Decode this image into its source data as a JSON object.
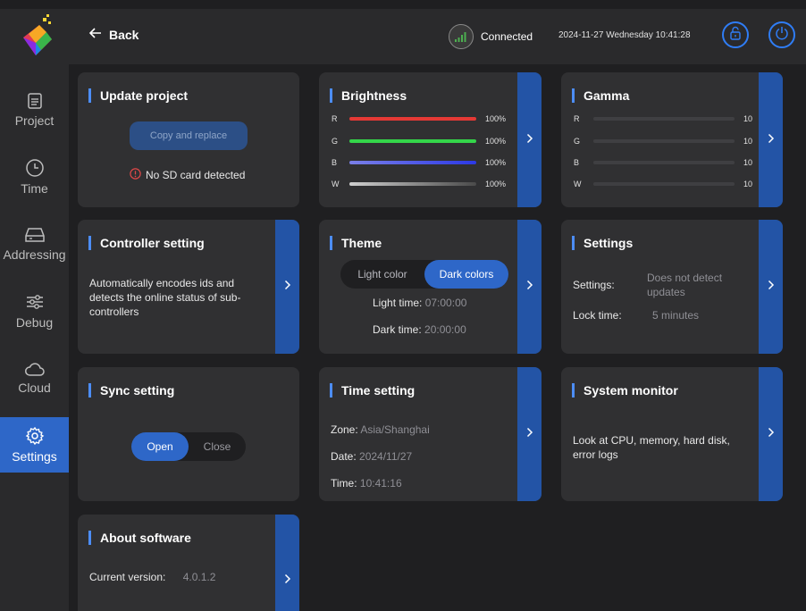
{
  "header": {
    "back_label": "Back",
    "connection_status": "Connected",
    "datetime": "2024-11-27 Wednesday 10:41:28"
  },
  "sidebar": {
    "items": [
      {
        "label": "Project",
        "icon": "document-icon"
      },
      {
        "label": "Time",
        "icon": "clock-icon"
      },
      {
        "label": "Addressing",
        "icon": "drive-icon"
      },
      {
        "label": "Debug",
        "icon": "sliders-icon"
      },
      {
        "label": "Cloud",
        "icon": "cloud-icon"
      },
      {
        "label": "Settings",
        "icon": "gear-icon",
        "active": true
      }
    ]
  },
  "update_project": {
    "title": "Update project",
    "button": "Copy and replace",
    "warning": "No SD card detected"
  },
  "brightness": {
    "title": "Brightness",
    "channels": [
      {
        "label": "R",
        "value": "100%",
        "color": "#e53935"
      },
      {
        "label": "G",
        "value": "100%",
        "color": "#34d64a"
      },
      {
        "label": "B",
        "value": "100%",
        "color": "#2c39e6"
      },
      {
        "label": "W",
        "value": "100%",
        "color": "#bdbdbd"
      }
    ]
  },
  "gamma": {
    "title": "Gamma",
    "channels": [
      {
        "label": "R",
        "value": "10"
      },
      {
        "label": "G",
        "value": "10"
      },
      {
        "label": "B",
        "value": "10"
      },
      {
        "label": "W",
        "value": "10"
      }
    ]
  },
  "controller": {
    "title": "Controller setting",
    "description": "Automatically encodes ids and detects the online status of sub-controllers"
  },
  "theme": {
    "title": "Theme",
    "light_option": "Light color",
    "dark_option": "Dark colors",
    "light_time_label": "Light time:",
    "light_time": "07:00:00",
    "dark_time_label": "Dark time:",
    "dark_time": "20:00:00"
  },
  "settings_card": {
    "title": "Settings",
    "settings_label": "Settings:",
    "settings_value": "Does not detect updates",
    "lock_label": "Lock time:",
    "lock_value": "5 minutes"
  },
  "sync": {
    "title": "Sync setting",
    "open": "Open",
    "close": "Close"
  },
  "time_setting": {
    "title": "Time setting",
    "zone_label": "Zone:",
    "zone": "Asia/Shanghai",
    "date_label": "Date:",
    "date": "2024/11/27",
    "time_label": "Time:",
    "time": "10:41:16"
  },
  "system_monitor": {
    "title": "System monitor",
    "description": "Look at CPU, memory, hard disk, error logs"
  },
  "about": {
    "title": "About software",
    "version_label": "Current version:",
    "version": "4.0.1.2"
  },
  "colors": {
    "accent": "#2e67c8",
    "strip": "#2354a6",
    "card": "#303032",
    "background": "#1f1f21"
  }
}
